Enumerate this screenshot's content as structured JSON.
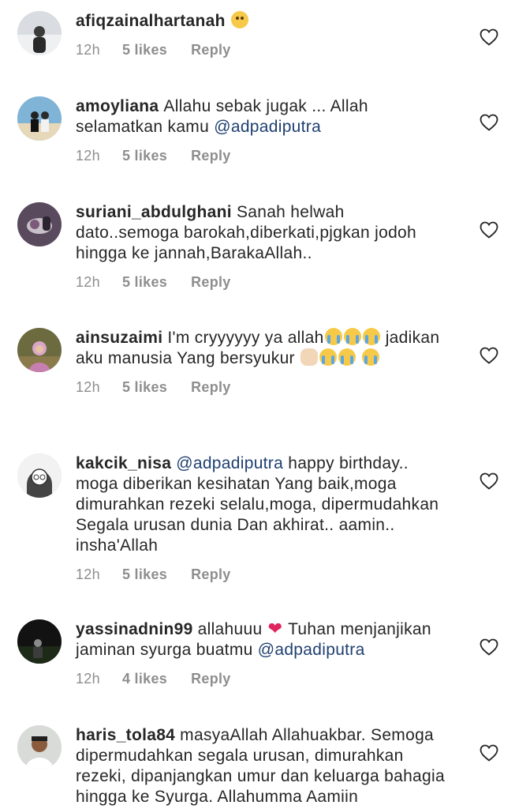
{
  "comments": [
    {
      "user": "afiqzainalhartanah",
      "text": "",
      "emoji": "😢",
      "time": "12h",
      "likes": "5 likes",
      "reply": "Reply"
    },
    {
      "user": "amoyliana",
      "text_a": "Allahu sebak jugak ... Allah selamatkan kamu ",
      "mention": "@adpadiputra",
      "time": "12h",
      "likes": "5 likes",
      "reply": "Reply"
    },
    {
      "user": "suriani_abdulghani",
      "text": "Sanah helwah dato..semoga barokah,diberkati,pjgkan jodoh hingga ke jannah,BarakaAllah..",
      "time": "12h",
      "likes": "5 likes",
      "reply": "Reply"
    },
    {
      "user": "ainsuzaimi",
      "text_a": "I'm cryyyyyy ya allah",
      "text_b": " jadikan aku manusia Yang bersyukur ",
      "time": "12h",
      "likes": "5 likes",
      "reply": "Reply"
    },
    {
      "user": "kakcik_nisa",
      "mention": "@adpadiputra",
      "text": "  happy birthday.. moga diberikan kesihatan Yang baik,moga dimurahkan rezeki selalu,moga, dipermudahkan Segala urusan dunia Dan akhirat.. aamin.. insha'Allah",
      "time": "12h",
      "likes": "5 likes",
      "reply": "Reply"
    },
    {
      "user": "yassinadnin99",
      "text_a": "allahuuu ",
      "text_b": " Tuhan menjanjikan jaminan syurga buatmu ",
      "mention": "@adpadiputra",
      "time": "12h",
      "likes": "4 likes",
      "reply": "Reply"
    },
    {
      "user": "haris_tola84",
      "text": "masyaAllah Allahuakbar. Semoga dipermudahkan segala urusan, dimurahkan rezeki, dipanjangkan umur dan keluarga bahagia hingga ke Syurga. Allahumma Aamiin"
    }
  ]
}
